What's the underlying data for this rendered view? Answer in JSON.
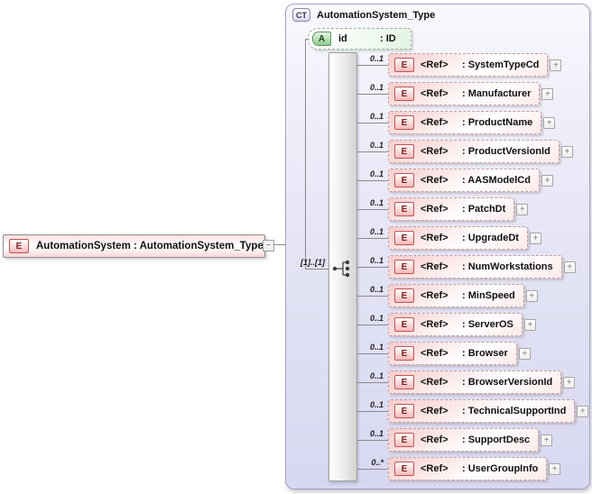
{
  "root_element": {
    "badge": "E",
    "label": "AutomationSystem : AutomationSystem_Type",
    "collapse_glyph": "−"
  },
  "complex_type": {
    "badge": "CT",
    "title": "AutomationSystem_Type",
    "attribute": {
      "badge": "A",
      "name": "id",
      "type": ": ID"
    },
    "compositor": {
      "kind": "sequence",
      "cardinality": "[1]..[1]"
    },
    "children": [
      {
        "badge": "E",
        "ref_label": "<Ref>",
        "name_label": ": SystemTypeCd",
        "cardinality": "0..1",
        "expand_glyph": "+"
      },
      {
        "badge": "E",
        "ref_label": "<Ref>",
        "name_label": ": Manufacturer",
        "cardinality": "0..1",
        "expand_glyph": "+"
      },
      {
        "badge": "E",
        "ref_label": "<Ref>",
        "name_label": ": ProductName",
        "cardinality": "0..1",
        "expand_glyph": "+"
      },
      {
        "badge": "E",
        "ref_label": "<Ref>",
        "name_label": ": ProductVersionId",
        "cardinality": "0..1",
        "expand_glyph": "+"
      },
      {
        "badge": "E",
        "ref_label": "<Ref>",
        "name_label": ": AASModelCd",
        "cardinality": "0..1",
        "expand_glyph": "+"
      },
      {
        "badge": "E",
        "ref_label": "<Ref>",
        "name_label": ": PatchDt",
        "cardinality": "0..1",
        "expand_glyph": "+"
      },
      {
        "badge": "E",
        "ref_label": "<Ref>",
        "name_label": ": UpgradeDt",
        "cardinality": "0..1",
        "expand_glyph": "+"
      },
      {
        "badge": "E",
        "ref_label": "<Ref>",
        "name_label": ": NumWorkstations",
        "cardinality": "0..1",
        "expand_glyph": "+"
      },
      {
        "badge": "E",
        "ref_label": "<Ref>",
        "name_label": ": MinSpeed",
        "cardinality": "0..1",
        "expand_glyph": "+"
      },
      {
        "badge": "E",
        "ref_label": "<Ref>",
        "name_label": ": ServerOS",
        "cardinality": "0..1",
        "expand_glyph": "+"
      },
      {
        "badge": "E",
        "ref_label": "<Ref>",
        "name_label": ": Browser",
        "cardinality": "0..1",
        "expand_glyph": "+"
      },
      {
        "badge": "E",
        "ref_label": "<Ref>",
        "name_label": ": BrowserVersionId",
        "cardinality": "0..1",
        "expand_glyph": "+"
      },
      {
        "badge": "E",
        "ref_label": "<Ref>",
        "name_label": ": TechnicalSupportInd",
        "cardinality": "0..1",
        "expand_glyph": "+"
      },
      {
        "badge": "E",
        "ref_label": "<Ref>",
        "name_label": ": SupportDesc",
        "cardinality": "0..1",
        "expand_glyph": "+"
      },
      {
        "badge": "E",
        "ref_label": "<Ref>",
        "name_label": ": UserGroupInfo",
        "cardinality": "0..*",
        "expand_glyph": "+"
      }
    ]
  },
  "colors": {
    "container_fill_top": "#f8f8fd",
    "container_fill_bottom": "#d7d7f0",
    "container_border": "#a2a2c2",
    "element_fill": "#f8cccc",
    "element_badge_border": "#c05454",
    "element_badge_text": "#7c2020",
    "attribute_fill": "#e2f4e2",
    "attribute_badge_border": "#5f965f",
    "connector_line": "#8a8a8a",
    "bar_fill": "#ececec"
  }
}
